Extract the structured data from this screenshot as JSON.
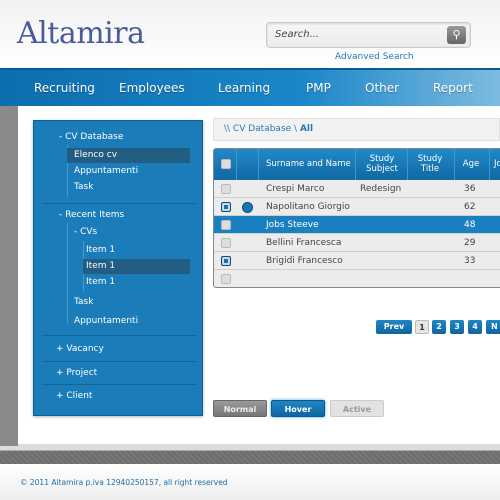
{
  "header": {
    "logo": "Altamira",
    "search_placeholder": "Search...",
    "advanced_search": "Advanved Search"
  },
  "nav": [
    "Recruiting",
    "Employees",
    "Learning",
    "PMP",
    "Other",
    "Report"
  ],
  "sidebar": {
    "cv_database": "- CV Database",
    "elenco": "Elenco cv",
    "appuntamenti": "Appuntamenti",
    "task": "Task",
    "recent": "- Recent Items",
    "cvs": "- CVs",
    "item1": "Item 1",
    "item2": "Item 1",
    "item3": "Item 1",
    "task2": "Task",
    "appuntamenti2": "Appuntamenti",
    "vacancy": "+ Vacancy",
    "project": "+ Project",
    "client": "+ Client"
  },
  "breadcrumb": {
    "prefix": "\\\\ CV Database \\ ",
    "current": "All"
  },
  "table": {
    "headers": [
      "Surname and Name",
      "Study Subject",
      "Study Title",
      "Age",
      "Jo"
    ],
    "rows": [
      {
        "name": "Crespi Marco",
        "subject": "Redesign",
        "title": "",
        "age": "36",
        "checked": false,
        "radio": false,
        "selected": false
      },
      {
        "name": "Napolitano Giorgio",
        "subject": "",
        "title": "",
        "age": "62",
        "checked": true,
        "radio": true,
        "selected": false
      },
      {
        "name": "Jobs Steeve",
        "subject": "",
        "title": "",
        "age": "48",
        "checked": false,
        "radio": false,
        "selected": true
      },
      {
        "name": "Bellini Francesca",
        "subject": "",
        "title": "",
        "age": "29",
        "checked": false,
        "radio": false,
        "selected": false
      },
      {
        "name": "Brigidi Francesco",
        "subject": "",
        "title": "",
        "age": "33",
        "checked": true,
        "radio": false,
        "selected": false
      },
      {
        "name": "",
        "subject": "",
        "title": "",
        "age": "",
        "checked": false,
        "radio": false,
        "selected": false
      }
    ]
  },
  "pagination": {
    "prev": "Prev",
    "pages": [
      "1",
      "2",
      "3",
      "4"
    ],
    "next": "N",
    "current": "1"
  },
  "buttons": {
    "normal": "Normal",
    "hover": "Hover",
    "active": "Active"
  },
  "footer": "© 2011 Altamira p.iva 12940250157, all right reserved",
  "colors": {
    "brand": "#1a7dba",
    "logo": "#4a5a9a"
  }
}
